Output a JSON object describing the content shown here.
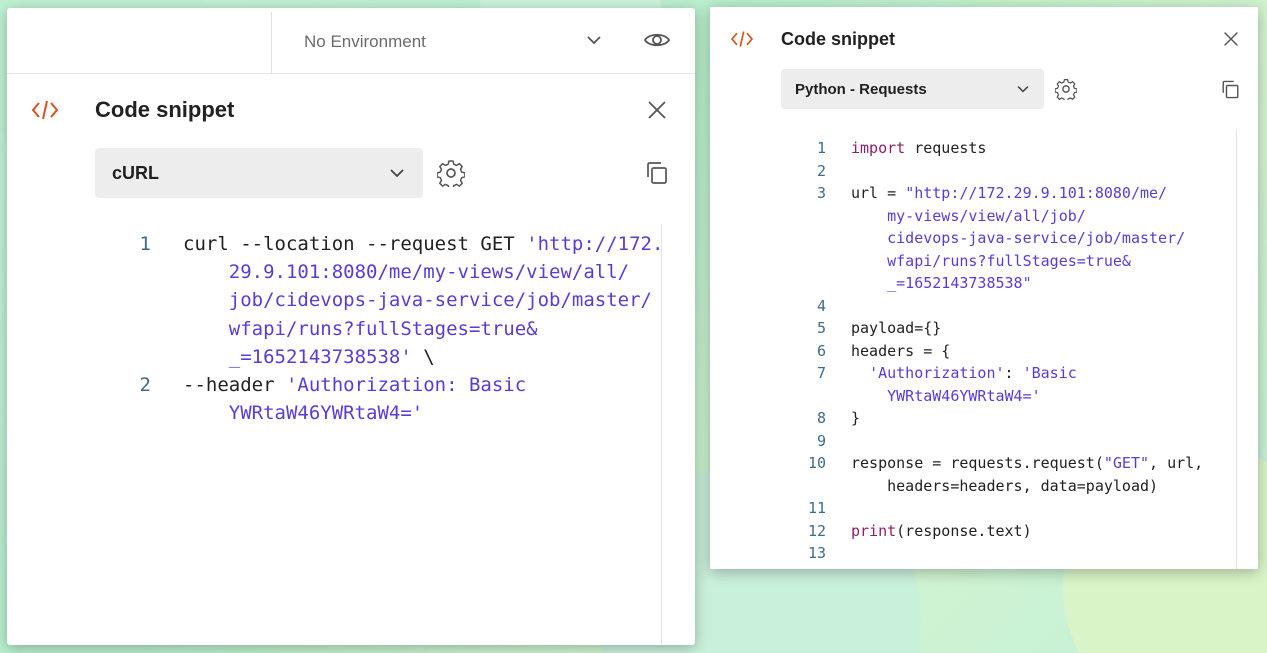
{
  "left_panel": {
    "environment": {
      "label": "No Environment"
    },
    "title": "Code snippet",
    "language": "cURL",
    "code_lines": [
      {
        "num": "1",
        "parts": [
          {
            "t": "curl --location --request GET ",
            "c": ""
          },
          {
            "t": "'http://172.",
            "c": "str"
          }
        ]
      },
      {
        "num": "",
        "parts": [
          {
            "t": "    29.9.101:8080/me/my-views/view/all/",
            "c": "str"
          }
        ]
      },
      {
        "num": "",
        "parts": [
          {
            "t": "    job/cidevops-java-service/job/master/",
            "c": "str"
          }
        ]
      },
      {
        "num": "",
        "parts": [
          {
            "t": "    wfapi/runs?fullStages=true&",
            "c": "str"
          }
        ]
      },
      {
        "num": "",
        "parts": [
          {
            "t": "    _=1652143738538'",
            "c": "str"
          },
          {
            "t": " \\",
            "c": ""
          }
        ]
      },
      {
        "num": "2",
        "parts": [
          {
            "t": "--header ",
            "c": ""
          },
          {
            "t": "'Authorization: Basic",
            "c": "str"
          }
        ]
      },
      {
        "num": "",
        "parts": [
          {
            "t": "    YWRtaW46YWRtaW4='",
            "c": "str"
          }
        ]
      }
    ]
  },
  "right_panel": {
    "title": "Code snippet",
    "language": "Python - Requests",
    "code_lines": [
      {
        "num": "1",
        "parts": [
          {
            "t": "import",
            "c": "kw"
          },
          {
            "t": " requests",
            "c": ""
          }
        ]
      },
      {
        "num": "2",
        "parts": []
      },
      {
        "num": "3",
        "parts": [
          {
            "t": "url = ",
            "c": ""
          },
          {
            "t": "\"http://172.29.9.101:8080/me/",
            "c": "str"
          }
        ]
      },
      {
        "num": "",
        "parts": [
          {
            "t": "    my-views/view/all/job/",
            "c": "str"
          }
        ]
      },
      {
        "num": "",
        "parts": [
          {
            "t": "    cidevops-java-service/job/master/",
            "c": "str"
          }
        ]
      },
      {
        "num": "",
        "parts": [
          {
            "t": "    wfapi/runs?fullStages=true&",
            "c": "str"
          }
        ]
      },
      {
        "num": "",
        "parts": [
          {
            "t": "    _=1652143738538\"",
            "c": "str"
          }
        ]
      },
      {
        "num": "4",
        "parts": []
      },
      {
        "num": "5",
        "parts": [
          {
            "t": "payload={}",
            "c": ""
          }
        ]
      },
      {
        "num": "6",
        "parts": [
          {
            "t": "headers = {",
            "c": ""
          }
        ]
      },
      {
        "num": "7",
        "parts": [
          {
            "t": "  ",
            "c": ""
          },
          {
            "t": "'Authorization'",
            "c": "str"
          },
          {
            "t": ": ",
            "c": ""
          },
          {
            "t": "'Basic",
            "c": "str"
          }
        ]
      },
      {
        "num": "",
        "parts": [
          {
            "t": "    YWRtaW46YWRtaW4='",
            "c": "str"
          }
        ]
      },
      {
        "num": "8",
        "parts": [
          {
            "t": "}",
            "c": ""
          }
        ]
      },
      {
        "num": "9",
        "parts": []
      },
      {
        "num": "10",
        "parts": [
          {
            "t": "response = requests.request(",
            "c": ""
          },
          {
            "t": "\"GET\"",
            "c": "str"
          },
          {
            "t": ", url,",
            "c": ""
          }
        ]
      },
      {
        "num": "",
        "parts": [
          {
            "t": "    headers=headers, data=payload)",
            "c": ""
          }
        ]
      },
      {
        "num": "11",
        "parts": []
      },
      {
        "num": "12",
        "parts": [
          {
            "t": "print",
            "c": "kw"
          },
          {
            "t": "(response.text)",
            "c": ""
          }
        ]
      },
      {
        "num": "13",
        "parts": []
      }
    ]
  },
  "colors": {
    "accent_icon": "#d4531c",
    "string": "#5b3bd6",
    "keyword": "#8c1f6b",
    "line_number": "#3d6b8c"
  },
  "icons": [
    "code-icon",
    "close-icon",
    "chevron-down-icon",
    "gear-icon",
    "copy-icon",
    "eye-icon"
  ]
}
